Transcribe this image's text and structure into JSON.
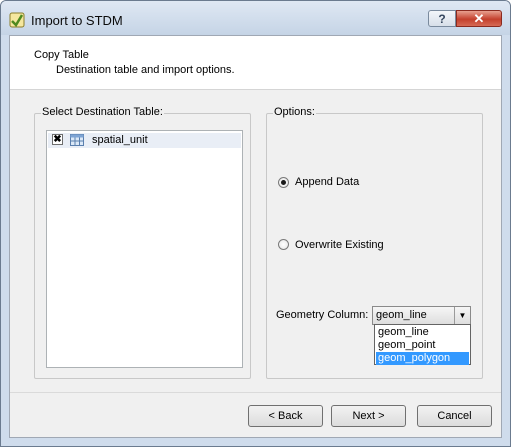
{
  "window": {
    "title": "Import to STDM",
    "help_label": "?",
    "close_label": "✕"
  },
  "header": {
    "title": "Copy Table",
    "subtitle": "Destination table and import options."
  },
  "destination": {
    "legend": "Select Destination Table:",
    "items": [
      {
        "label": "spatial_unit",
        "checked": true,
        "icon": "table-icon"
      }
    ]
  },
  "options": {
    "legend": "Options:",
    "append_label": "Append Data",
    "overwrite_label": "Overwrite Existing",
    "selected": "Append Data",
    "geometry_label": "Geometry Column:",
    "geometry_value": "geom_line",
    "geometry_options": [
      "geom_line",
      "geom_point",
      "geom_polygon"
    ],
    "highlighted_option": "geom_polygon"
  },
  "buttons": {
    "back": "< Back",
    "next": "Next >",
    "cancel": "Cancel"
  },
  "colors": {
    "highlight": "#3399ff",
    "close": "#c4402d"
  }
}
